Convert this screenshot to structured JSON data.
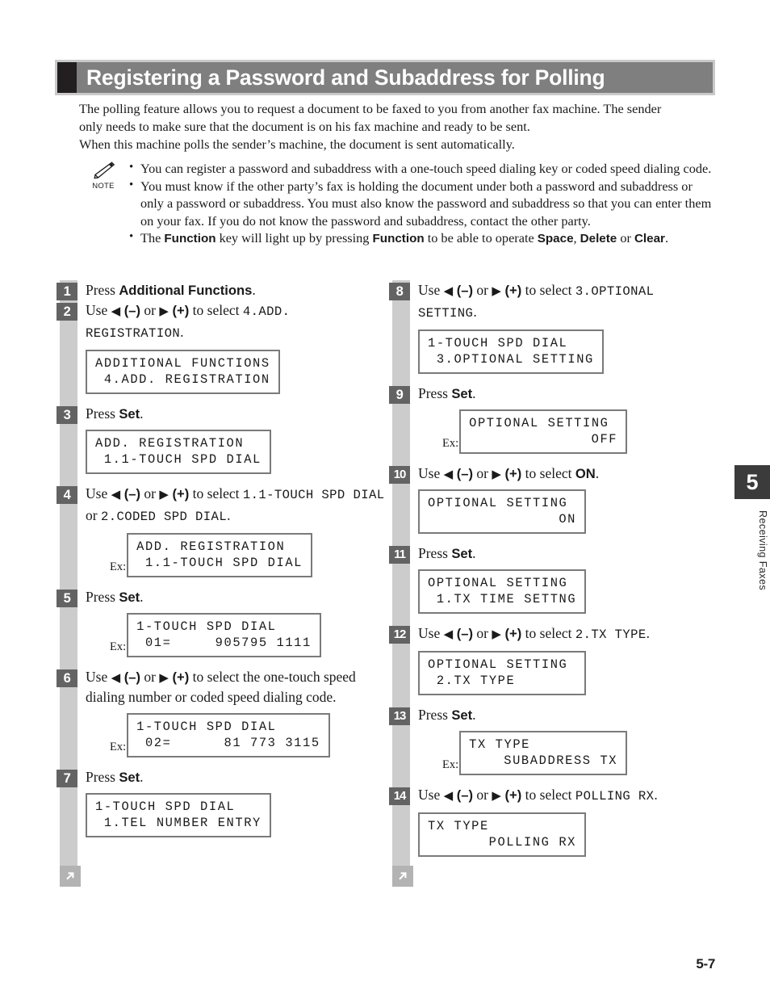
{
  "header": {
    "title": "Registering a Password and Subaddress for Polling"
  },
  "intro": {
    "line1": "The polling feature allows you to request a document to be faxed to you from another fax machine. The sender",
    "line2": "only needs to make sure that the document is on his fax machine and ready to be sent.",
    "line3": "When this machine polls the sender’s machine, the document is sent automatically."
  },
  "note": {
    "icon": "pencil-note-icon",
    "label": "NOTE",
    "items": [
      {
        "parts": [
          {
            "t": "You can register a password and subaddress with a one-touch speed dialing key or coded speed dialing code.",
            "bold": false
          }
        ]
      },
      {
        "parts": [
          {
            "t": "You must know if the other party’s fax is holding the document under both a password and subaddress or only a password or subaddress. You must also know the password and subaddress so that you can enter them on your fax. If you do not know the password and subaddress, contact the other party.",
            "bold": false
          }
        ]
      },
      {
        "parts": [
          {
            "t": "The ",
            "bold": false
          },
          {
            "t": "Function",
            "bold": true
          },
          {
            "t": " key will light up by pressing ",
            "bold": false
          },
          {
            "t": "Function",
            "bold": true
          },
          {
            "t": " to be able to operate ",
            "bold": false
          },
          {
            "t": "Space",
            "bold": true
          },
          {
            "t": ", ",
            "bold": false
          },
          {
            "t": "Delete",
            "bold": true
          },
          {
            "t": " or ",
            "bold": false
          },
          {
            "t": "Clear",
            "bold": true
          },
          {
            "t": ".",
            "bold": false
          }
        ]
      }
    ]
  },
  "steps_left": [
    {
      "num": "1",
      "parts": [
        {
          "t": "Press ",
          "style": "normal"
        },
        {
          "t": "Additional Functions",
          "style": "bold"
        },
        {
          "t": ".",
          "style": "normal"
        }
      ]
    },
    {
      "num": "2",
      "parts": [
        {
          "t": "Use ",
          "style": "normal"
        },
        {
          "t": "◀",
          "style": "glyph"
        },
        {
          "t": " (–)",
          "style": "bold"
        },
        {
          "t": " or ",
          "style": "normal"
        },
        {
          "t": "▶",
          "style": "glyph"
        },
        {
          "t": " (+)",
          "style": "bold"
        },
        {
          "t": " to select ",
          "style": "normal"
        },
        {
          "t": "4.ADD. REGISTRATION",
          "style": "mono"
        },
        {
          "t": ".",
          "style": "normal"
        }
      ],
      "lcd": {
        "ex": "",
        "indent": false,
        "lines": [
          {
            "text": "ADDITIONAL FUNCTIONS",
            "align": "left"
          },
          {
            "text": " 4.ADD. REGISTRATION",
            "align": "left"
          }
        ]
      }
    },
    {
      "num": "3",
      "parts": [
        {
          "t": "Press ",
          "style": "normal"
        },
        {
          "t": "Set",
          "style": "bold"
        },
        {
          "t": ".",
          "style": "normal"
        }
      ],
      "lcd": {
        "ex": "",
        "indent": false,
        "lines": [
          {
            "text": "ADD. REGISTRATION",
            "align": "left"
          },
          {
            "text": " 1.1-TOUCH SPD DIAL",
            "align": "left"
          }
        ]
      }
    },
    {
      "num": "4",
      "parts": [
        {
          "t": "Use ",
          "style": "normal"
        },
        {
          "t": "◀",
          "style": "glyph"
        },
        {
          "t": " (–)",
          "style": "bold"
        },
        {
          "t": " or ",
          "style": "normal"
        },
        {
          "t": "▶",
          "style": "glyph"
        },
        {
          "t": " (+)",
          "style": "bold"
        },
        {
          "t": " to select ",
          "style": "normal"
        },
        {
          "t": "1.1-TOUCH SPD DIAL",
          "style": "mono"
        },
        {
          "t": " or ",
          "style": "normal"
        },
        {
          "t": "2.CODED SPD DIAL",
          "style": "mono"
        },
        {
          "t": ".",
          "style": "normal"
        }
      ],
      "lcd": {
        "ex": "Ex:",
        "indent": true,
        "lines": [
          {
            "text": "ADD. REGISTRATION",
            "align": "left"
          },
          {
            "text": " 1.1-TOUCH SPD DIAL",
            "align": "left"
          }
        ]
      }
    },
    {
      "num": "5",
      "parts": [
        {
          "t": "Press ",
          "style": "normal"
        },
        {
          "t": "Set",
          "style": "bold"
        },
        {
          "t": ".",
          "style": "normal"
        }
      ],
      "lcd": {
        "ex": "Ex:",
        "indent": true,
        "lines": [
          {
            "text": "1-TOUCH SPD DIAL",
            "align": "left"
          },
          {
            "text": " 01=     905795 1111",
            "align": "left"
          }
        ]
      }
    },
    {
      "num": "6",
      "parts": [
        {
          "t": "Use ",
          "style": "normal"
        },
        {
          "t": "◀",
          "style": "glyph"
        },
        {
          "t": " (–)",
          "style": "bold"
        },
        {
          "t": " or ",
          "style": "normal"
        },
        {
          "t": "▶",
          "style": "glyph"
        },
        {
          "t": " (+)",
          "style": "bold"
        },
        {
          "t": " to select the one-touch speed dialing number or coded speed dialing code.",
          "style": "normal"
        }
      ],
      "lcd": {
        "ex": "Ex:",
        "indent": true,
        "lines": [
          {
            "text": "1-TOUCH SPD DIAL",
            "align": "left"
          },
          {
            "text": " 02=      81 773 3115",
            "align": "left"
          }
        ]
      }
    },
    {
      "num": "7",
      "parts": [
        {
          "t": "Press ",
          "style": "normal"
        },
        {
          "t": "Set",
          "style": "bold"
        },
        {
          "t": ".",
          "style": "normal"
        }
      ],
      "lcd": {
        "ex": "",
        "indent": false,
        "lines": [
          {
            "text": "1-TOUCH SPD DIAL",
            "align": "left"
          },
          {
            "text": " 1.TEL NUMBER ENTRY",
            "align": "left"
          }
        ]
      }
    }
  ],
  "steps_right": [
    {
      "num": "8",
      "parts": [
        {
          "t": "Use ",
          "style": "normal"
        },
        {
          "t": "◀",
          "style": "glyph"
        },
        {
          "t": " (–)",
          "style": "bold"
        },
        {
          "t": " or ",
          "style": "normal"
        },
        {
          "t": "▶",
          "style": "glyph"
        },
        {
          "t": " (+)",
          "style": "bold"
        },
        {
          "t": " to select ",
          "style": "normal"
        },
        {
          "t": "3.OPTIONAL SETTING",
          "style": "mono"
        },
        {
          "t": ".",
          "style": "normal"
        }
      ],
      "lcd": {
        "ex": "",
        "indent": false,
        "lines": [
          {
            "text": "1-TOUCH SPD DIAL",
            "align": "left"
          },
          {
            "text": " 3.OPTIONAL SETTING",
            "align": "left"
          }
        ]
      }
    },
    {
      "num": "9",
      "parts": [
        {
          "t": "Press ",
          "style": "normal"
        },
        {
          "t": "Set",
          "style": "bold"
        },
        {
          "t": ".",
          "style": "normal"
        }
      ],
      "lcd": {
        "ex": "Ex:",
        "indent": true,
        "lines": [
          {
            "text": "OPTIONAL SETTING",
            "align": "left"
          },
          {
            "text": "OFF",
            "align": "right"
          }
        ]
      }
    },
    {
      "num": "10",
      "parts": [
        {
          "t": "Use ",
          "style": "normal"
        },
        {
          "t": "◀",
          "style": "glyph"
        },
        {
          "t": " (–)",
          "style": "bold"
        },
        {
          "t": " or ",
          "style": "normal"
        },
        {
          "t": "▶",
          "style": "glyph"
        },
        {
          "t": " (+)",
          "style": "bold"
        },
        {
          "t": " to select ",
          "style": "normal"
        },
        {
          "t": "ON",
          "style": "bold"
        },
        {
          "t": ".",
          "style": "normal"
        }
      ],
      "lcd": {
        "ex": "",
        "indent": false,
        "lines": [
          {
            "text": "OPTIONAL SETTING",
            "align": "left"
          },
          {
            "text": "ON",
            "align": "right"
          }
        ]
      }
    },
    {
      "num": "11",
      "parts": [
        {
          "t": "Press ",
          "style": "normal"
        },
        {
          "t": "Set",
          "style": "bold"
        },
        {
          "t": ".",
          "style": "normal"
        }
      ],
      "lcd": {
        "ex": "",
        "indent": false,
        "lines": [
          {
            "text": "OPTIONAL SETTING",
            "align": "left"
          },
          {
            "text": " 1.TX TIME SETTNG",
            "align": "left"
          }
        ]
      }
    },
    {
      "num": "12",
      "parts": [
        {
          "t": "Use ",
          "style": "normal"
        },
        {
          "t": "◀",
          "style": "glyph"
        },
        {
          "t": " (–)",
          "style": "bold"
        },
        {
          "t": " or ",
          "style": "normal"
        },
        {
          "t": "▶",
          "style": "glyph"
        },
        {
          "t": " (+)",
          "style": "bold"
        },
        {
          "t": " to select ",
          "style": "normal"
        },
        {
          "t": "2.TX TYPE",
          "style": "mono"
        },
        {
          "t": ".",
          "style": "normal"
        }
      ],
      "lcd": {
        "ex": "",
        "indent": false,
        "lines": [
          {
            "text": "OPTIONAL SETTING",
            "align": "left"
          },
          {
            "text": " 2.TX TYPE",
            "align": "left"
          }
        ]
      }
    },
    {
      "num": "13",
      "parts": [
        {
          "t": "Press ",
          "style": "normal"
        },
        {
          "t": "Set",
          "style": "bold"
        },
        {
          "t": ".",
          "style": "normal"
        }
      ],
      "lcd": {
        "ex": "Ex:",
        "indent": true,
        "lines": [
          {
            "text": "TX TYPE",
            "align": "left"
          },
          {
            "text": "SUBADDRESS TX",
            "align": "right"
          }
        ]
      }
    },
    {
      "num": "14",
      "parts": [
        {
          "t": "Use ",
          "style": "normal"
        },
        {
          "t": "◀",
          "style": "glyph"
        },
        {
          "t": " (–)",
          "style": "bold"
        },
        {
          "t": " or ",
          "style": "normal"
        },
        {
          "t": "▶",
          "style": "glyph"
        },
        {
          "t": " (+)",
          "style": "bold"
        },
        {
          "t": " to select ",
          "style": "normal"
        },
        {
          "t": "POLLING RX",
          "style": "mono"
        },
        {
          "t": ".",
          "style": "normal"
        }
      ],
      "lcd": {
        "ex": "",
        "indent": false,
        "lines": [
          {
            "text": "TX TYPE",
            "align": "left"
          },
          {
            "text": "POLLING RX",
            "align": "right"
          }
        ]
      }
    }
  ],
  "continue_marker": {
    "icon": "arrow-up-right-icon"
  },
  "chapter_tab": {
    "number": "5",
    "label": "Receiving Faxes"
  },
  "footer": {
    "page_number": "5-7"
  },
  "colors": {
    "header_band": "#c9c9c9",
    "header_bar": "#7f7f7f",
    "header_square": "#231f20",
    "rail": "#cccccc",
    "step_badge": "#636363",
    "lcd_border": "#7a7a7a",
    "chapter_num_bg": "#3b3b3b",
    "continue_marker": "#b3b3b3"
  }
}
